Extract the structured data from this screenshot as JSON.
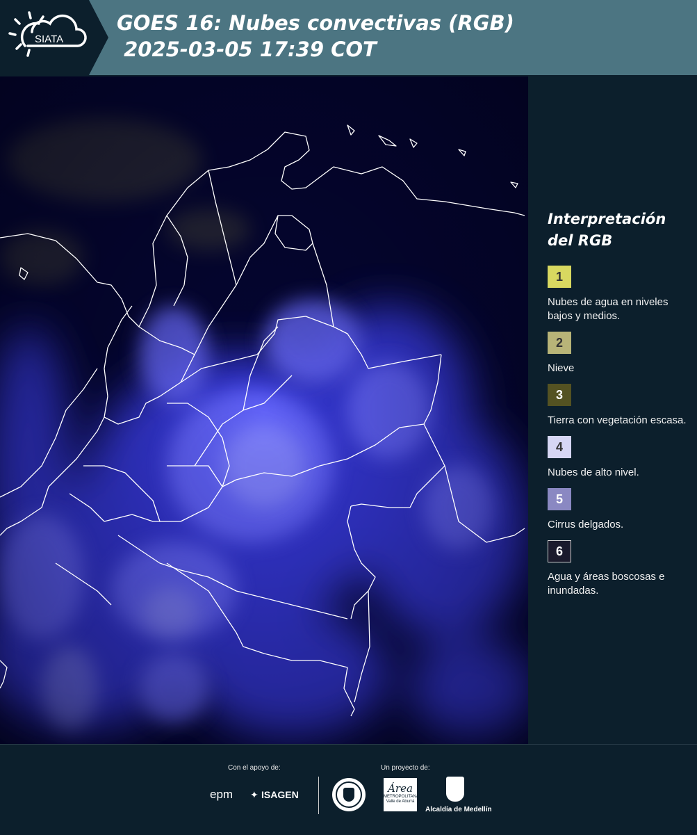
{
  "header": {
    "logo_text": "SIATA",
    "title_line1": "GOES 16: Nubes convectivas (RGB)",
    "title_line2": " 2025-03-05 17:39 COT"
  },
  "map": {
    "image_alt": "GOES-16 convective clouds RGB satellite image over Colombia"
  },
  "legend": {
    "title_line1": "Interpretación",
    "title_line2": "del RGB",
    "items": [
      {
        "num": "1",
        "color": "#d8d860",
        "label": "Nubes de agua en niveles bajos y medios."
      },
      {
        "num": "2",
        "color": "#b8b478",
        "label": "Nieve"
      },
      {
        "num": "3",
        "color": "#545222",
        "label": "Tierra con vegetación escasa."
      },
      {
        "num": "4",
        "color": "#d6d6f4",
        "label": "Nubes de alto nivel."
      },
      {
        "num": "5",
        "color": "#8a88c2",
        "label": "Cirrus delgados."
      },
      {
        "num": "6",
        "color": "#1a1a2c",
        "label": "Agua y áreas boscosas e inundadas."
      }
    ]
  },
  "footer": {
    "support_label": "Con el apoyo de:",
    "project_label": "Un proyecto de:",
    "epm": "epm",
    "isagen": "ISAGEN",
    "area_logo_text": "Área",
    "area_sub": "METROPOLITANA",
    "area_sub2": "Valle de Aburrá",
    "alcaldia": "Alcaldía de Medellín"
  },
  "colors": {
    "header_bg": "#4c7582",
    "page_bg": "#0c1f2c",
    "map_bg": "#04052a",
    "cloud_blue": "#4a4cf0"
  }
}
